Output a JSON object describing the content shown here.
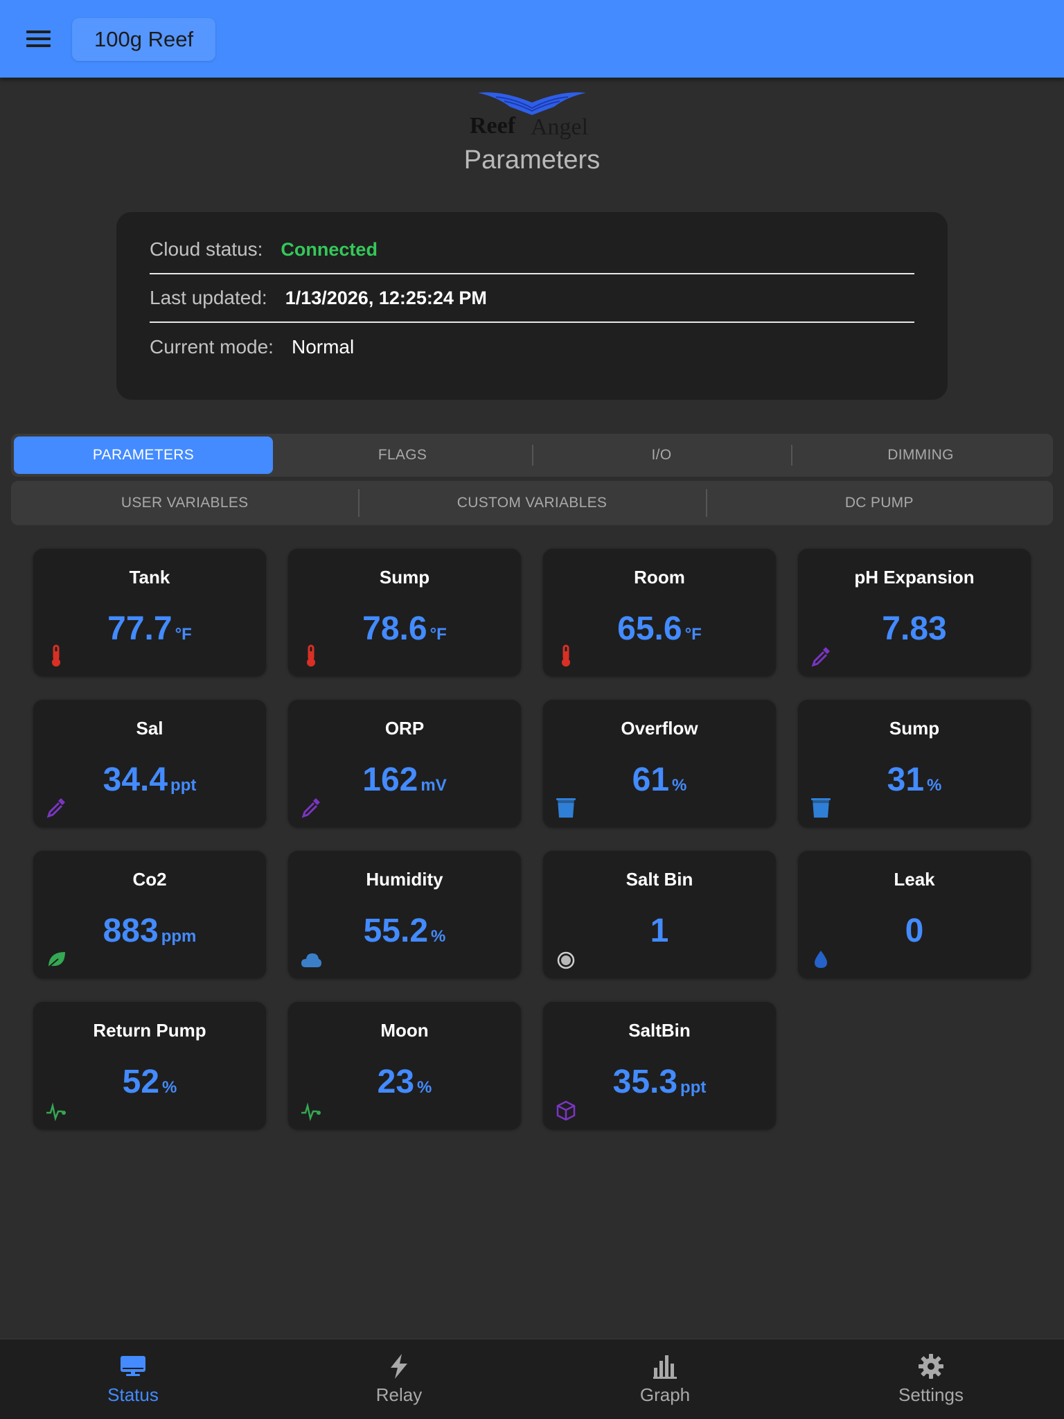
{
  "header": {
    "controller_name": "100g Reef"
  },
  "logo": {
    "text_main": "Reef",
    "text_sub": "Angel"
  },
  "page": {
    "title": "Parameters"
  },
  "status": {
    "cloud_label": "Cloud status:",
    "cloud_value": "Connected",
    "updated_label": "Last updated:",
    "updated_value": "1/13/2026, 12:25:24 PM",
    "mode_label": "Current mode:",
    "mode_value": "Normal"
  },
  "tabs_primary": [
    "PARAMETERS",
    "FLAGS",
    "I/O",
    "DIMMING"
  ],
  "tabs_secondary": [
    "USER VARIABLES",
    "CUSTOM VARIABLES",
    "DC PUMP"
  ],
  "cards": [
    {
      "title": "Tank",
      "value": "77.7",
      "unit": "°F",
      "icon": "thermometer-icon"
    },
    {
      "title": "Sump",
      "value": "78.6",
      "unit": "°F",
      "icon": "thermometer-icon"
    },
    {
      "title": "Room",
      "value": "65.6",
      "unit": "°F",
      "icon": "thermometer-icon"
    },
    {
      "title": "pH Expansion",
      "value": "7.83",
      "unit": "",
      "icon": "eyedropper-icon"
    },
    {
      "title": "Sal",
      "value": "34.4",
      "unit": "ppt",
      "icon": "eyedropper-icon"
    },
    {
      "title": "ORP",
      "value": "162",
      "unit": "mV",
      "icon": "eyedropper-icon"
    },
    {
      "title": "Overflow",
      "value": "61",
      "unit": "%",
      "icon": "bucket-icon"
    },
    {
      "title": "Sump",
      "value": "31",
      "unit": "%",
      "icon": "bucket-icon"
    },
    {
      "title": "Co2",
      "value": "883",
      "unit": "ppm",
      "icon": "leaf-icon"
    },
    {
      "title": "Humidity",
      "value": "55.2",
      "unit": "%",
      "icon": "cloud-icon"
    },
    {
      "title": "Salt Bin",
      "value": "1",
      "unit": "",
      "icon": "radio-dot-icon"
    },
    {
      "title": "Leak",
      "value": "0",
      "unit": "",
      "icon": "water-drop-icon"
    },
    {
      "title": "Return Pump",
      "value": "52",
      "unit": "%",
      "icon": "pulse-icon"
    },
    {
      "title": "Moon",
      "value": "23",
      "unit": "%",
      "icon": "pulse-icon"
    },
    {
      "title": "SaltBin",
      "value": "35.3",
      "unit": "ppt",
      "icon": "cube-icon"
    }
  ],
  "bottom_nav": [
    {
      "label": "Status",
      "icon": "monitor-icon",
      "active": true
    },
    {
      "label": "Relay",
      "icon": "bolt-icon",
      "active": false
    },
    {
      "label": "Graph",
      "icon": "bar-chart-icon",
      "active": false
    },
    {
      "label": "Settings",
      "icon": "gear-icon",
      "active": false
    }
  ],
  "colors": {
    "accent": "#438bff",
    "connected": "#34c85a",
    "thermometer": "#d93025",
    "eyedropper": "#7b35c4",
    "bucket": "#2f7fd6",
    "leaf": "#34a853",
    "cloud": "#3b7fc9",
    "drop": "#2563c9",
    "pulse": "#34a853",
    "cube": "#7b35c4"
  }
}
